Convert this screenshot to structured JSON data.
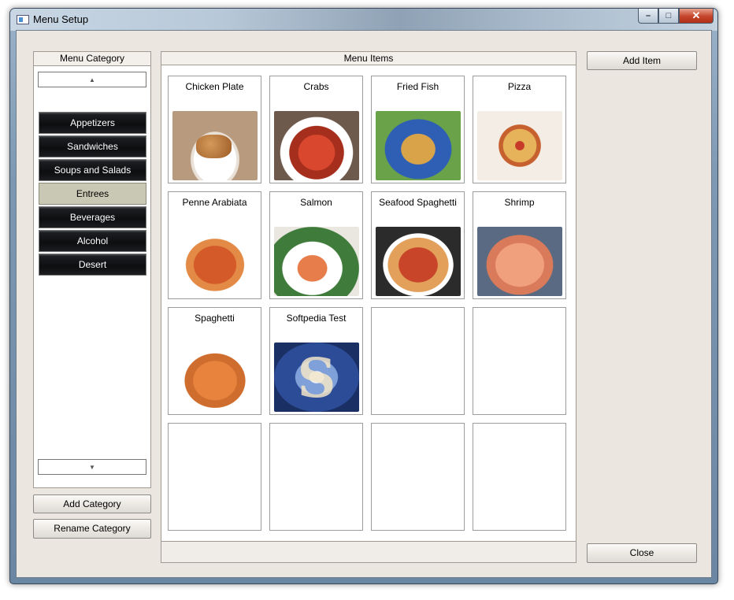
{
  "window": {
    "title": "Menu Setup",
    "minimize": "–",
    "maximize": "□",
    "close": "✕"
  },
  "category_panel": {
    "header": "Menu Category",
    "scroll_up": "▲",
    "scroll_down": "▼",
    "items": [
      {
        "label": "Appetizers",
        "selected": false
      },
      {
        "label": "Sandwiches",
        "selected": false
      },
      {
        "label": "Soups and Salads",
        "selected": false
      },
      {
        "label": "Entrees",
        "selected": true
      },
      {
        "label": "Beverages",
        "selected": false
      },
      {
        "label": "Alcohol",
        "selected": false
      },
      {
        "label": "Desert",
        "selected": false
      }
    ],
    "add_button": "Add Category",
    "rename_button": "Rename Category"
  },
  "items_panel": {
    "header": "Menu Items",
    "items": [
      {
        "label": "Chicken Plate",
        "image": "chicken-plate-photo"
      },
      {
        "label": "Crabs",
        "image": "crabs-photo"
      },
      {
        "label": "Fried Fish",
        "image": "fried-fish-photo"
      },
      {
        "label": "Pizza",
        "image": "pizza-photo"
      },
      {
        "label": "Penne Arabiata",
        "image": "penne-photo"
      },
      {
        "label": "Salmon",
        "image": "salmon-photo"
      },
      {
        "label": "Seafood Spaghetti",
        "image": "seafood-spaghetti-photo"
      },
      {
        "label": "Shrimp",
        "image": "shrimp-photo"
      },
      {
        "label": "Spaghetti",
        "image": "spaghetti-photo"
      },
      {
        "label": "Softpedia Test",
        "image": "softpedia-logo-image"
      }
    ]
  },
  "actions": {
    "add_item": "Add Item",
    "close": "Close"
  }
}
